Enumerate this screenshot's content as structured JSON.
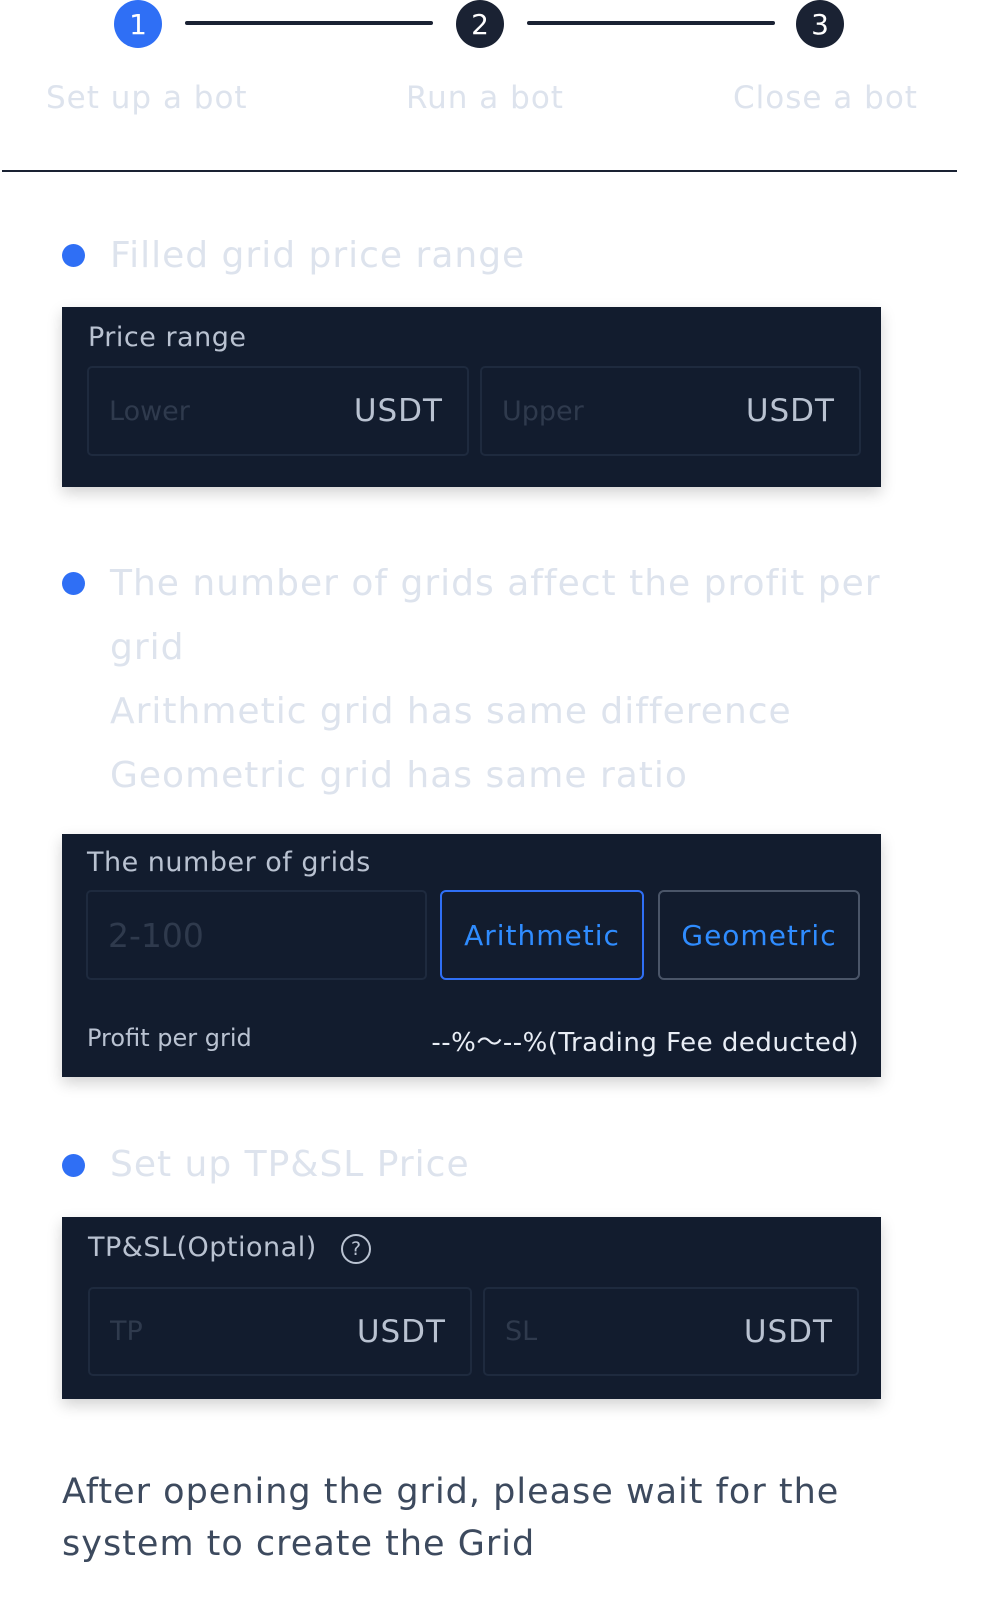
{
  "stepper": {
    "steps": [
      {
        "number": "1",
        "label": "Set up a bot",
        "state": "active"
      },
      {
        "number": "2",
        "label": "Run a bot",
        "state": "inactive"
      },
      {
        "number": "3",
        "label": "Close a bot",
        "state": "inactive"
      }
    ]
  },
  "section_price": {
    "heading": "Filled grid price range",
    "panel_label": "Price range",
    "lower": {
      "placeholder": "Lower",
      "unit": "USDT"
    },
    "upper": {
      "placeholder": "Upper",
      "unit": "USDT"
    }
  },
  "section_grids": {
    "heading_lines": [
      "The number of grids affect the profit per",
      "grid",
      "Arithmetic grid has same difference",
      "Geometric grid has same ratio"
    ],
    "panel_label": "The number of grids",
    "grids_input": {
      "placeholder": "2-100"
    },
    "arithmetic_label": "Arithmetic",
    "geometric_label": "Geometric",
    "selected_mode": "Arithmetic",
    "profit_label": "Profit per grid",
    "profit_value": "--%～--%(Trading Fee deducted)"
  },
  "section_tpsl": {
    "heading": "Set up TP&SL Price",
    "panel_label": "TP&SL(Optional)",
    "help_glyph": "?",
    "tp": {
      "placeholder": "TP",
      "unit": "USDT"
    },
    "sl": {
      "placeholder": "SL",
      "unit": "USDT"
    }
  },
  "footer": {
    "text": "After opening the grid, please wait for the system to create the Grid"
  },
  "colors": {
    "accent": "#2f6ff5",
    "panel_bg": "#121c2e",
    "muted_text": "#dde3ed",
    "button_text": "#2f8cff"
  },
  "icons": {
    "bullet": "bullet-dot-icon",
    "help": "help-circle-icon"
  }
}
